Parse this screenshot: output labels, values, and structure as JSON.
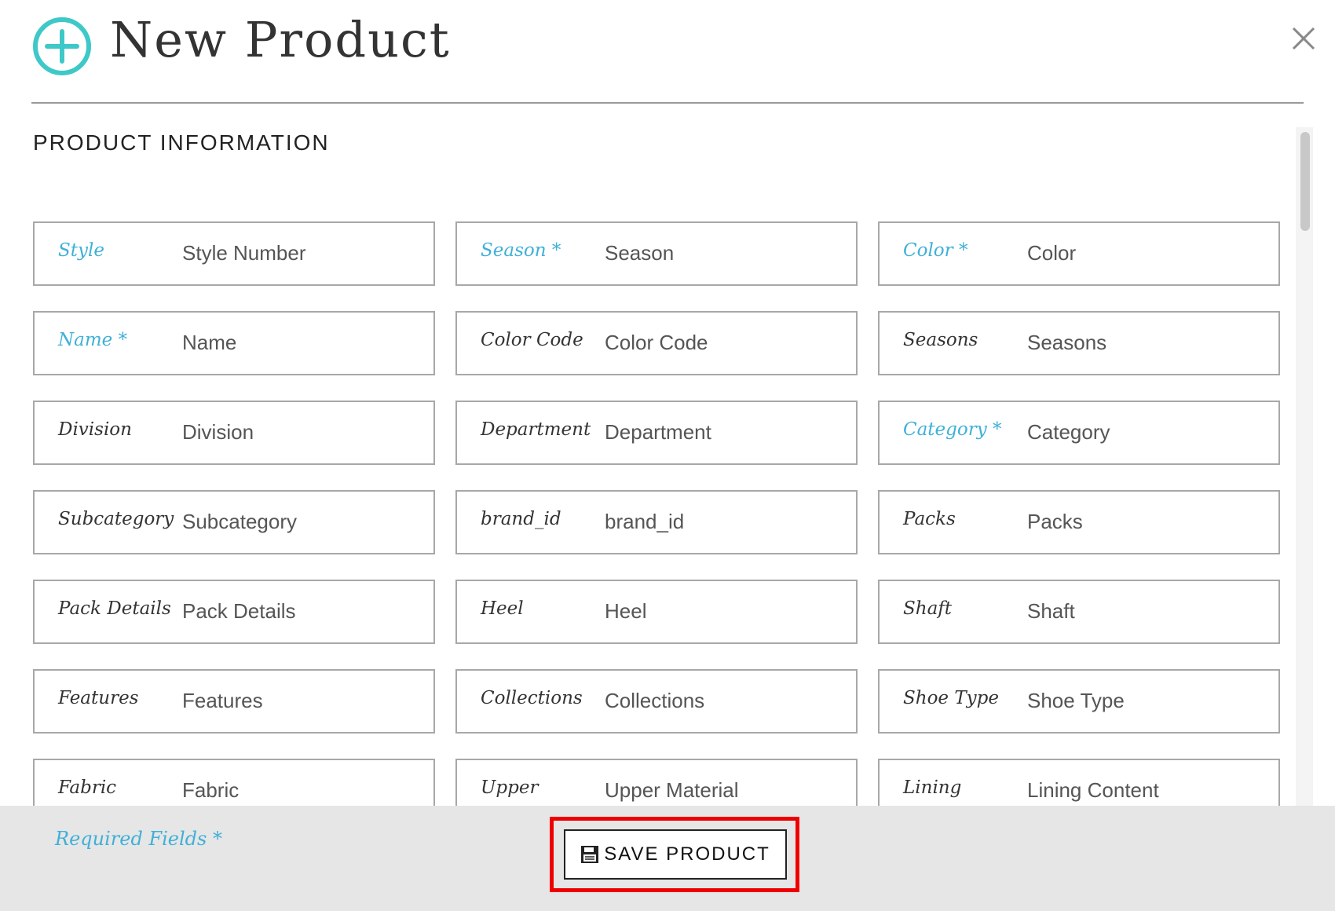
{
  "header": {
    "title": "New Product",
    "accent_color": "#3ec8c8",
    "icon": "plus-circle-icon",
    "close_icon": "close-icon"
  },
  "section": {
    "title": "PRODUCT INFORMATION"
  },
  "fields": [
    {
      "label": "Style",
      "required": false,
      "highlight": true,
      "placeholder": "Style Number",
      "key": "style"
    },
    {
      "label": "Season *",
      "required": true,
      "highlight": true,
      "placeholder": "Season",
      "key": "season"
    },
    {
      "label": "Color *",
      "required": true,
      "highlight": true,
      "placeholder": "Color",
      "key": "color"
    },
    {
      "label": "Name *",
      "required": true,
      "highlight": true,
      "placeholder": "Name",
      "key": "name"
    },
    {
      "label": "Color Code",
      "required": false,
      "highlight": false,
      "placeholder": "Color Code",
      "key": "color-code"
    },
    {
      "label": "Seasons",
      "required": false,
      "highlight": false,
      "placeholder": "Seasons",
      "key": "seasons"
    },
    {
      "label": "Division",
      "required": false,
      "highlight": false,
      "placeholder": "Division",
      "key": "division"
    },
    {
      "label": "Department",
      "required": false,
      "highlight": false,
      "placeholder": "Department",
      "key": "department"
    },
    {
      "label": "Category *",
      "required": true,
      "highlight": true,
      "placeholder": "Category",
      "key": "category"
    },
    {
      "label": "Subcategory",
      "required": false,
      "highlight": false,
      "placeholder": "Subcategory",
      "key": "subcategory"
    },
    {
      "label": "brand_id",
      "required": false,
      "highlight": false,
      "placeholder": "brand_id",
      "key": "brand-id"
    },
    {
      "label": "Packs",
      "required": false,
      "highlight": false,
      "placeholder": "Packs",
      "key": "packs"
    },
    {
      "label": "Pack Details",
      "required": false,
      "highlight": false,
      "placeholder": "Pack Details",
      "key": "pack-details"
    },
    {
      "label": "Heel",
      "required": false,
      "highlight": false,
      "placeholder": "Heel",
      "key": "heel"
    },
    {
      "label": "Shaft",
      "required": false,
      "highlight": false,
      "placeholder": "Shaft",
      "key": "shaft"
    },
    {
      "label": "Features",
      "required": false,
      "highlight": false,
      "placeholder": "Features",
      "key": "features"
    },
    {
      "label": "Collections",
      "required": false,
      "highlight": false,
      "placeholder": "Collections",
      "key": "collections"
    },
    {
      "label": "Shoe Type",
      "required": false,
      "highlight": false,
      "placeholder": "Shoe Type",
      "key": "shoe-type"
    },
    {
      "label": "Fabric",
      "required": false,
      "highlight": false,
      "placeholder": "Fabric",
      "key": "fabric"
    },
    {
      "label": "Upper",
      "required": false,
      "highlight": false,
      "placeholder": "Upper Material",
      "key": "upper"
    },
    {
      "label": "Lining",
      "required": false,
      "highlight": false,
      "placeholder": "Lining Content",
      "key": "lining"
    }
  ],
  "footer": {
    "required_note": "Required Fields *",
    "save_label": "SAVE PRODUCT",
    "save_icon": "save-icon",
    "highlight_color": "#ee0000",
    "required_color": "#3fb0d8"
  }
}
